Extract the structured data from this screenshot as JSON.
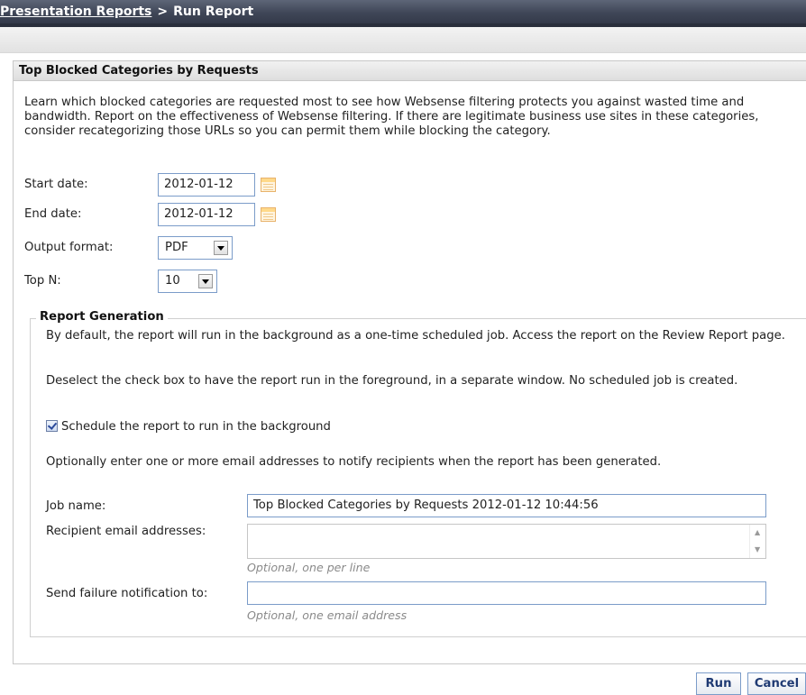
{
  "breadcrumb": {
    "parent": "Presentation Reports",
    "separator": ">",
    "current": "Run Report"
  },
  "panel": {
    "title": "Top Blocked Categories by Requests",
    "description": "Learn which blocked categories are requested most to see how Websense filtering protects you against wasted time and bandwidth. Report on the effectiveness of Websense filtering. If there are legitimate business use sites in these categories, consider recategorizing those URLs so you can permit them while blocking the category."
  },
  "form": {
    "start_date": {
      "label": "Start date:",
      "value": "2012-01-12"
    },
    "end_date": {
      "label": "End date:",
      "value": "2012-01-12"
    },
    "output_format": {
      "label": "Output format:",
      "value": "PDF"
    },
    "top_n": {
      "label": "Top N:",
      "value": "10"
    }
  },
  "report_generation": {
    "legend": "Report Generation",
    "text1": "By default, the report will run in the background as a one-time scheduled job. Access the report on the Review Report page.",
    "text2": "Deselect the check box to have the report run in the foreground, in a separate window. No scheduled job is created.",
    "checkbox_label": "Schedule the report to run in the background",
    "checkbox_checked": true,
    "text3": "Optionally enter one or more email addresses to notify recipients when the report has been generated.",
    "job_name": {
      "label": "Job name:",
      "value": "Top Blocked Categories by Requests 2012-01-12 10:44:56"
    },
    "recipients": {
      "label": "Recipient email addresses:",
      "value": "",
      "hint": "Optional, one per line"
    },
    "failure": {
      "label": "Send failure notification to:",
      "value": "",
      "hint": "Optional, one email address"
    }
  },
  "buttons": {
    "run": "Run",
    "cancel": "Cancel"
  },
  "colors": {
    "title_bar": "#3f4657",
    "input_border": "#7b9cc9",
    "button_text": "#1f3a73"
  }
}
